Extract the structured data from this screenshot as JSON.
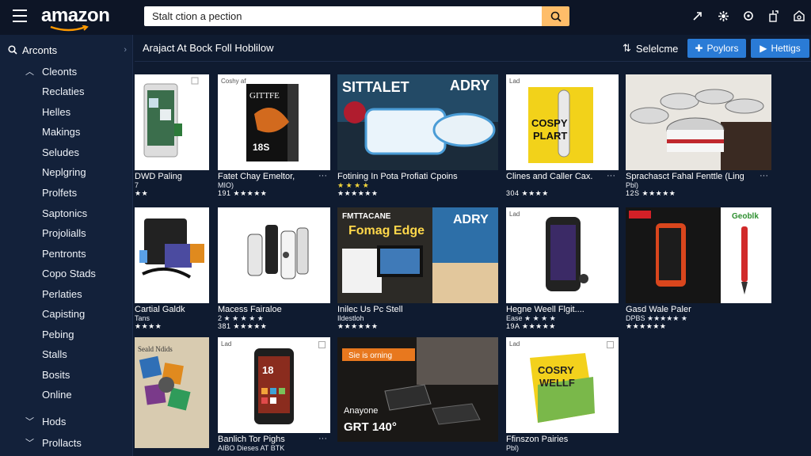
{
  "header": {
    "logo": "amazon",
    "search_value": "Stalt ction a pection"
  },
  "sidebar": {
    "head_label": "Arconts",
    "items": [
      "Cleonts",
      "Reclaties",
      "Helles",
      "Makings",
      "Seludes",
      "Neplgring",
      "Prolfets",
      "Saptonics",
      "Projolialls",
      "Pentronts",
      "Copo Stads",
      "Perlaties",
      "Capisting",
      "Pebing",
      "Stalls",
      "Bosits",
      "Online"
    ],
    "groups": [
      "Hods",
      "Prollacts"
    ]
  },
  "toolbar": {
    "breadcrumb": "Arajact At Bock Foll Hoblilow",
    "select_label": "Selelcme",
    "btn1": "Poylors",
    "btn2": "Hettigs"
  },
  "products": [
    {
      "title": "DWD Paling",
      "sub": "7",
      "stars": "★★"
    },
    {
      "title": "Fatet Chay Emeltor,",
      "sub": "MIO)",
      "stars": "191 ★★★★★",
      "tag": "Coshy af",
      "art": "GITTFE 18S"
    },
    {
      "title": "Fotining In Pota Profiati Cpoins",
      "sub": "★ ★ ★ ★",
      "stars": "★★★★★★",
      "art1": "SITTALET",
      "art2": "ADRY"
    },
    {
      "title": "Clines and Caller Cax.",
      "sub": "",
      "stars": "304 ★★★★",
      "tag": "Lad",
      "art": "COSPY PLART"
    },
    {
      "title": "Sprachasct Fahal Fenttle (Ling",
      "sub": "Pbl)",
      "stars": "12S ★★★★★"
    },
    {
      "title": "Cartial Galdk",
      "sub": "Tans",
      "stars": "★★★★"
    },
    {
      "title": "Macess Fairaloe",
      "sub": "2 ★ ★ ★ ★ ★",
      "stars": "381 ★★★★★"
    },
    {
      "title": "Inilec Us Pc Stell",
      "sub": "Ildestloh",
      "stars": "★★★★★★",
      "art1": "FMTTACANE",
      "art2": "Fomag Edge",
      "art3": "ADRY"
    },
    {
      "title": "Hegne Weell Flgit....",
      "sub": "Ease ★ ★ ★ ★",
      "stars": "19A ★★★★★",
      "tag": "Lad"
    },
    {
      "title": "Gasd Wale Paler",
      "sub": "DPBS ★★★★★ ★",
      "stars": "★★★★★★",
      "art": "Geoblk"
    },
    {
      "title": "",
      "sub": "",
      "stars": ""
    },
    {
      "title": "Banlich Tor Pighs",
      "sub": "AIBO Dieses AT BTK",
      "stars": "",
      "tag": "Lad"
    },
    {
      "title": "",
      "sub": "",
      "stars": "",
      "art1": "Sie is orning",
      "art2": "Anayone",
      "art3": "GRT 140°"
    },
    {
      "title": "Ffinszon Pairies",
      "sub": "Pbl)",
      "stars": "",
      "tag": "Lad",
      "art": "COSRY WELLF"
    }
  ],
  "colors": {
    "bg": "#0f1b30",
    "sidebar": "#13213a",
    "accent": "#2a7bd6",
    "search_btn": "#febd69",
    "logo_smile": "#ff9900"
  }
}
